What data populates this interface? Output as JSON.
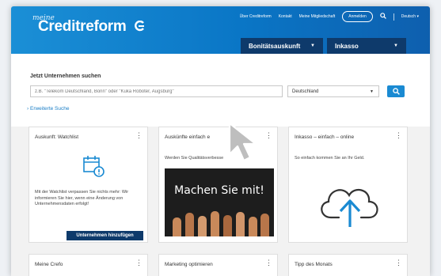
{
  "header": {
    "logo_prefix": "meine",
    "logo_name": "Creditreform",
    "topnav": [
      "Über Creditreform",
      "Kontakt",
      "Meine Mitgliedschaft"
    ],
    "login_label": "Anmelden",
    "language_label": "Deutsch ▾",
    "tabs": [
      {
        "label": "Bonitätsauskunft",
        "caret": "▼"
      },
      {
        "label": "Inkasso",
        "caret": "▼"
      }
    ]
  },
  "search": {
    "title": "Jetzt Unternehmen suchen",
    "placeholder": "z.B. \"Telekom Deutschland, Bonn\" oder \"Kuka Roboter, Augsburg\"",
    "country_value": "Deutschland",
    "country_caret": "▼",
    "advanced_link": "Erweiterte Suche"
  },
  "cards": [
    {
      "title": "Auskunft: Watchlist",
      "menu": "⋮",
      "text": "Mit der Watchlist verpassen Sie nichts mehr: Wir informieren Sie hier, wenn eine Änderung von Unternehmensdaten erfolgt!",
      "button": "Unternehmen hinzufügen"
    },
    {
      "title": "Auskünfte einfach e",
      "menu": "⋮",
      "text": "Werden Sie Qualitätsverbesse",
      "image_text": "Machen Sie mit!"
    },
    {
      "title": "Inkasso – einfach – online",
      "menu": "⋮",
      "text": "So einfach kommen Sie an Ihr Geld."
    },
    {
      "title": "Meine Crefo",
      "menu": "⋮"
    },
    {
      "title": "Marketing optimieren",
      "menu": "⋮"
    },
    {
      "title": "Tipp des Monats",
      "menu": "⋮"
    }
  ],
  "colors": {
    "brand_blue": "#0a76c6",
    "navy": "#0e3a6b",
    "link": "#1a7ec6"
  },
  "icons": [
    "search-icon",
    "calendar-alert-icon",
    "cloud-upload-icon",
    "kebab-menu-icon",
    "chevron-right-icon",
    "mouse-cursor-icon"
  ]
}
